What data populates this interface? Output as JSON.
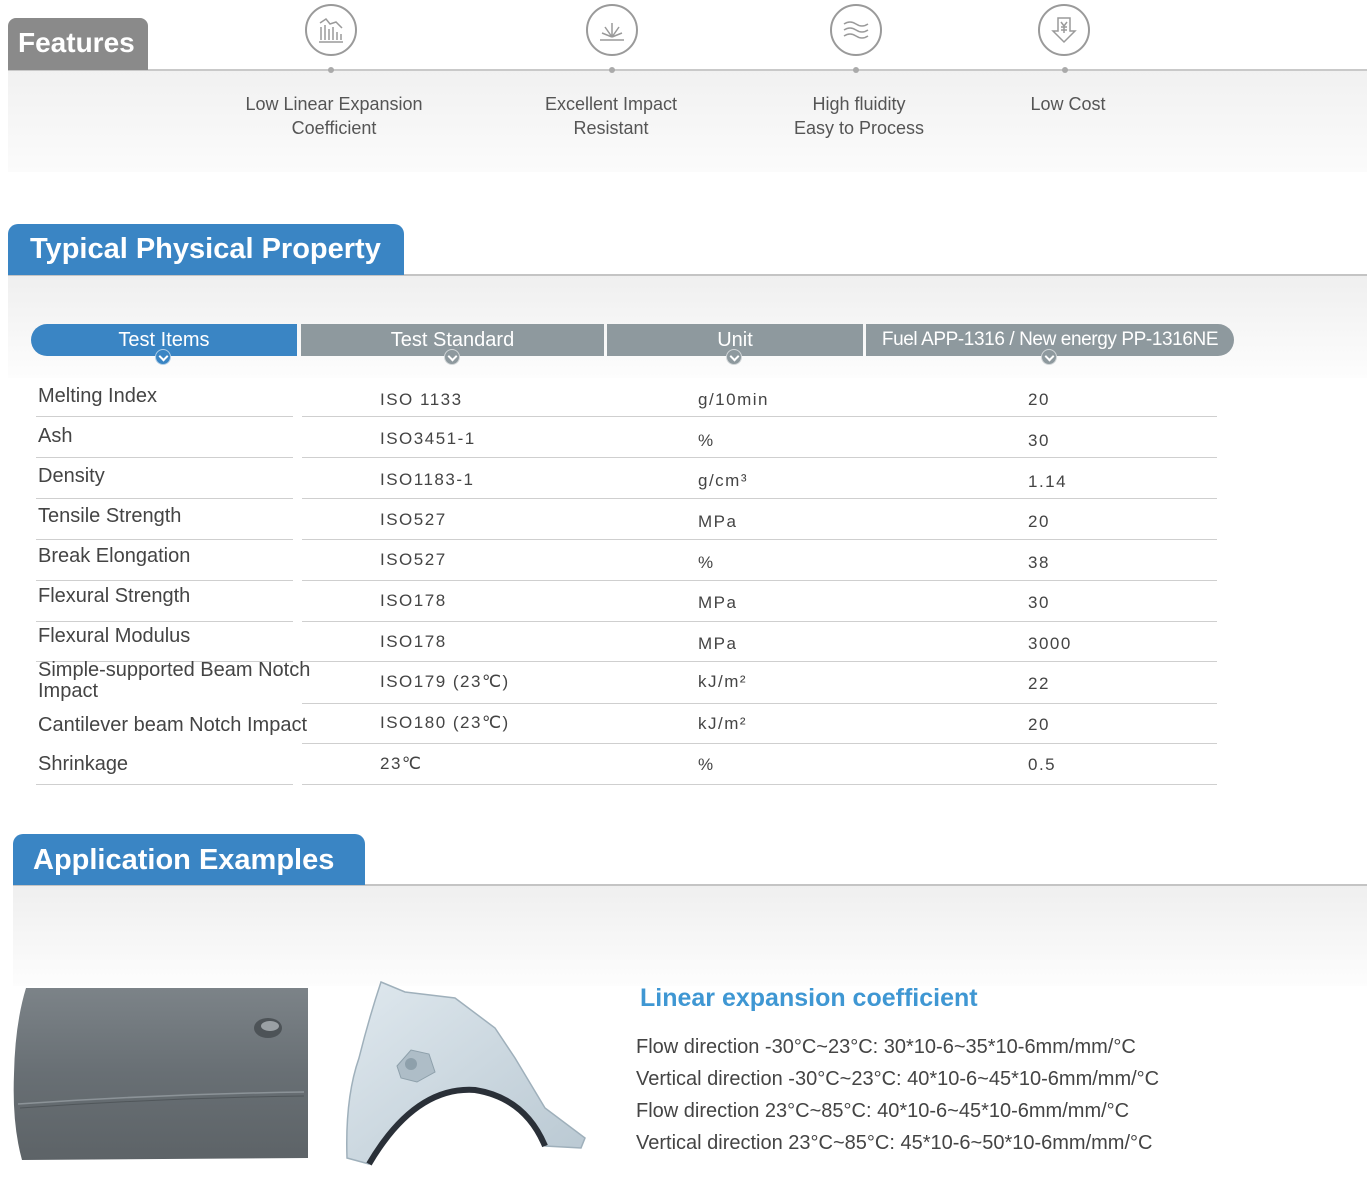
{
  "features": {
    "title": "Features",
    "items": [
      {
        "icon": "chart-decline-icon",
        "label": "Low Linear Expansion\nCoefficient"
      },
      {
        "icon": "impact-burst-icon",
        "label": "Excellent Impact\nResistant"
      },
      {
        "icon": "waves-icon",
        "label": "High fluidity\nEasy to Process"
      },
      {
        "icon": "yen-down-icon",
        "label": "Low Cost"
      }
    ]
  },
  "property": {
    "title": "Typical Physical Property",
    "headers": [
      "Test Items",
      "Test Standard",
      "Unit",
      "Fuel APP-1316 / New energy PP-1316NE"
    ],
    "rows": [
      {
        "item": "Melting Index",
        "standard": "ISO  1133",
        "unit": "g/10min",
        "value": "20"
      },
      {
        "item": "Ash",
        "standard": "ISO3451-1",
        "unit": "%",
        "value": "30"
      },
      {
        "item": "Density",
        "standard": "ISO1183-1",
        "unit": "g/cm³",
        "value": "1.14"
      },
      {
        "item": "Tensile Strength",
        "standard": "ISO527",
        "unit": "MPa",
        "value": "20"
      },
      {
        "item": "Break Elongation",
        "standard": "ISO527",
        "unit": "%",
        "value": "38"
      },
      {
        "item": "Flexural Strength",
        "standard": "ISO178",
        "unit": "MPa",
        "value": "30"
      },
      {
        "item": "Flexural Modulus",
        "standard": "ISO178",
        "unit": "MPa",
        "value": "3000"
      },
      {
        "item": "Simple-supported Beam Notch Impact",
        "standard": "ISO179 (23℃)",
        "unit": "kJ/m²",
        "value": "22"
      },
      {
        "item": "Cantilever beam Notch Impact",
        "standard": "ISO180 (23℃)",
        "unit": "kJ/m²",
        "value": "20"
      },
      {
        "item": "Shrinkage",
        "standard": "23℃",
        "unit": "%",
        "value": "0.5"
      }
    ]
  },
  "application": {
    "title": "Application Examples",
    "subtitle": "Linear expansion coefficient",
    "lines": [
      "Flow direction -30°C~23°C: 30*10-6~35*10-6mm/mm/°C",
      "Vertical direction -30°C~23°C: 40*10-6~45*10-6mm/mm/°C",
      "Flow direction 23°C~85°C: 40*10-6~45*10-6mm/mm/°C",
      "Vertical direction 23°C~85°C: 45*10-6~50*10-6mm/mm/°C"
    ],
    "images": [
      "car-door-panel-image",
      "car-fender-image"
    ]
  },
  "colors": {
    "accent_blue": "#3a85c4",
    "header_gray": "#8e999e",
    "title_blue": "#3f97d3"
  }
}
